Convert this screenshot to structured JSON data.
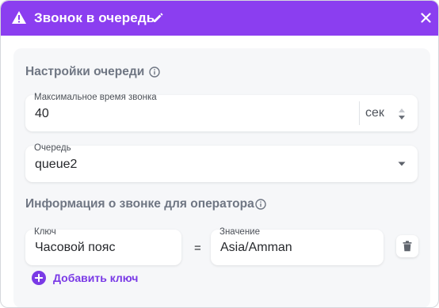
{
  "header": {
    "title": "Звонок в очередь",
    "icons": {
      "warning": "warning-triangle-icon",
      "edit": "pencil-icon",
      "close": "close-icon"
    },
    "background": "#8b3ef0"
  },
  "queue_settings": {
    "section_title": "Настройки очереди",
    "max_call_time": {
      "label": "Максимальное время звонка",
      "value": "40",
      "unit": "сек"
    },
    "queue": {
      "label": "Очередь",
      "value": "queue2"
    }
  },
  "call_info": {
    "section_title": "Информация о звонке для оператора",
    "rows": [
      {
        "key_label": "Ключ",
        "key_value": "Часовой пояс",
        "separator": "=",
        "value_label": "Значение",
        "value_value": "Asia/Amman"
      }
    ],
    "add_key_label": "Добавить ключ"
  },
  "colors": {
    "accent": "#8b3ef0",
    "link": "#7a3ae6",
    "muted_heading": "#6f7683"
  }
}
